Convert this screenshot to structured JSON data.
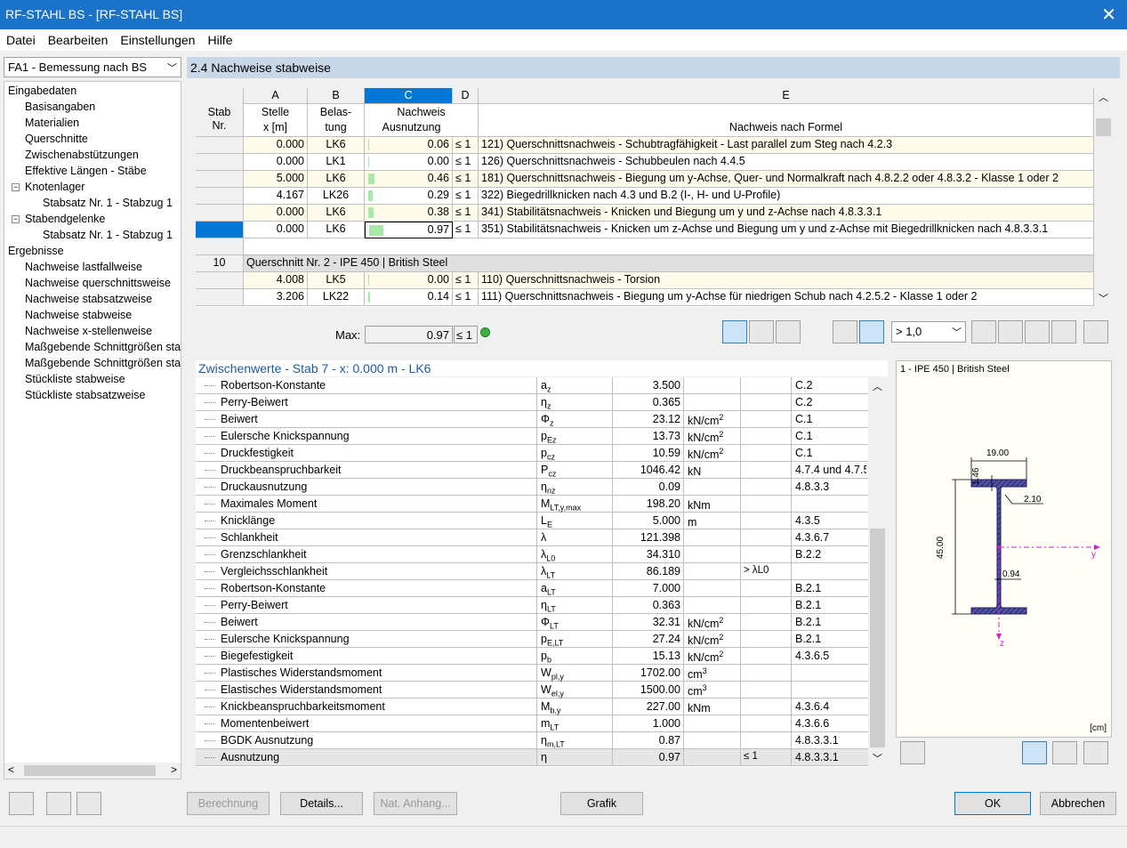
{
  "window": {
    "title": "RF-STAHL BS - [RF-STAHL BS]"
  },
  "menu": [
    "Datei",
    "Bearbeiten",
    "Einstellungen",
    "Hilfe"
  ],
  "case_select": "FA1 - Bemessung nach BS",
  "nav": {
    "input_header": "Eingabedaten",
    "input_items": [
      "Basisangaben",
      "Materialien",
      "Querschnitte",
      "Zwischenabstützungen",
      "Effektive Längen - Stäbe"
    ],
    "knotenlager": "Knotenlager",
    "knotenlager_child": "Stabsatz Nr. 1 - Stabzug 1",
    "stabendgelenke": "Stabendgelenke",
    "stabendgelenke_child": "Stabsatz Nr. 1 - Stabzug 1",
    "results_header": "Ergebnisse",
    "result_items": [
      "Nachweise lastfallweise",
      "Nachweise querschnittsweise",
      "Nachweise stabsatzweise",
      "Nachweise stabweise",
      "Nachweise x-stellenweise",
      "Maßgebende Schnittgrößen sta",
      "Maßgebende Schnittgrößen sta",
      "Stückliste stabweise",
      "Stückliste stabsatzweise"
    ]
  },
  "section_title": "2.4 Nachweise stabweise",
  "grid": {
    "col_letters": [
      "A",
      "B",
      "C",
      "D",
      "E"
    ],
    "h_stab": "Stab",
    "h_nr": "Nr.",
    "h_stelle": "Stelle",
    "h_x": "x [m]",
    "h_bel1": "Belas-",
    "h_bel2": "tung",
    "h_nach": "Nachweis",
    "h_aus": "Ausnutzung",
    "h_formel": "Nachweis nach Formel",
    "rows": [
      {
        "x": "0.000",
        "lk": "LK6",
        "val": "0.06",
        "le": "≤ 1",
        "f": "121) Querschnittsnachweis - Schubtragfähigkeit - Last parallel zum Steg nach 4.2.3",
        "fill": 0.06
      },
      {
        "x": "0.000",
        "lk": "LK1",
        "val": "0.00",
        "le": "≤ 1",
        "f": "126) Querschnittsnachweis - Schubbeulen nach 4.4.5",
        "fill": 0.0
      },
      {
        "x": "5.000",
        "lk": "LK6",
        "val": "0.46",
        "le": "≤ 1",
        "f": "181) Querschnittsnachweis - Biegung um y-Achse, Quer- und Normalkraft nach 4.8.2.2 oder 4.8.3.2 - Klasse 1 oder 2",
        "fill": 0.46
      },
      {
        "x": "4.167",
        "lk": "LK26",
        "val": "0.29",
        "le": "≤ 1",
        "f": "322) Biegedrillknicken nach 4.3 und B.2 (I-, H- und U-Profile)",
        "fill": 0.29
      },
      {
        "x": "0.000",
        "lk": "LK6",
        "val": "0.38",
        "le": "≤ 1",
        "f": "341) Stabilitätsnachweis - Knicken und Biegung um y und z-Achse nach 4.8.3.3.1",
        "fill": 0.38
      },
      {
        "x": "0.000",
        "lk": "LK6",
        "val": "0.97",
        "le": "≤ 1",
        "f": "351) Stabilitätsnachweis - Knicken um z-Achse und Biegung um y und z-Achse mit Biegedrillknicken nach 4.8.3.3.1",
        "fill": 0.97
      }
    ],
    "group_nr": "10",
    "group_label": "Querschnitt Nr.  2 - IPE 450 | British Steel",
    "rows2": [
      {
        "x": "4.008",
        "lk": "LK5",
        "val": "0.00",
        "le": "≤ 1",
        "f": "110) Querschnittsnachweis - Torsion",
        "fill": 0.0
      },
      {
        "x": "3.206",
        "lk": "LK22",
        "val": "0.14",
        "le": "≤ 1",
        "f": "111) Querschnittsnachweis - Biegung um y-Achse für niedrigen Schub nach 4.2.5.2 - Klasse 1 oder 2",
        "fill": 0.14
      }
    ]
  },
  "max": {
    "label": "Max:",
    "value": "0.97",
    "le": "≤ 1"
  },
  "factor_select": "> 1,0",
  "zw": {
    "title": "Zwischenwerte  -  Stab 7  -  x: 0.000 m  -  LK6",
    "rows": [
      {
        "n": "Robertson-Konstante",
        "s": "a",
        "sub": "z",
        "v": "3.500",
        "u": "",
        "u_sup": "",
        "cmp": "",
        "ref": "C.2"
      },
      {
        "n": "Perry-Beiwert",
        "s": "η",
        "sub": "z",
        "v": "0.365",
        "u": "",
        "u_sup": "",
        "cmp": "",
        "ref": "C.2"
      },
      {
        "n": "Beiwert",
        "s": "Φ",
        "sub": "z",
        "v": "23.12",
        "u": "kN/cm",
        "u_sup": "2",
        "cmp": "",
        "ref": "C.1"
      },
      {
        "n": "Eulersche Knickspannung",
        "s": "p",
        "sub": "Ez",
        "v": "13.73",
        "u": "kN/cm",
        "u_sup": "2",
        "cmp": "",
        "ref": "C.1"
      },
      {
        "n": "Druckfestigkeit",
        "s": "p",
        "sub": "cz",
        "v": "10.59",
        "u": "kN/cm",
        "u_sup": "2",
        "cmp": "",
        "ref": "C.1"
      },
      {
        "n": "Druckbeanspruchbarkeit",
        "s": "P",
        "sub": "cz",
        "v": "1046.42",
        "u": "kN",
        "u_sup": "",
        "cmp": "",
        "ref": "4.7.4 und 4.7.5"
      },
      {
        "n": "Druckausnutzung",
        "s": "η",
        "sub": "nz",
        "v": "0.09",
        "u": "",
        "u_sup": "",
        "cmp": "",
        "ref": "4.8.3.3"
      },
      {
        "n": "Maximales Moment",
        "s": "M",
        "sub": "LT,y,max",
        "v": "198.20",
        "u": "kNm",
        "u_sup": "",
        "cmp": "",
        "ref": ""
      },
      {
        "n": "Knicklänge",
        "s": "L",
        "sub": "E",
        "v": "5.000",
        "u": "m",
        "u_sup": "",
        "cmp": "",
        "ref": "4.3.5"
      },
      {
        "n": "Schlankheit",
        "s": "λ",
        "sub": "",
        "v": "121.398",
        "u": "",
        "u_sup": "",
        "cmp": "",
        "ref": "4.3.6.7"
      },
      {
        "n": "Grenzschlankheit",
        "s": "λ",
        "sub": "L0",
        "v": "34.310",
        "u": "",
        "u_sup": "",
        "cmp": "",
        "ref": "B.2.2"
      },
      {
        "n": "Vergleichsschlankheit",
        "s": "λ",
        "sub": "LT",
        "v": "86.189",
        "u": "",
        "u_sup": "",
        "cmp": "> λL0",
        "ref": ""
      },
      {
        "n": "Robertson-Konstante",
        "s": "a",
        "sub": "LT",
        "v": "7.000",
        "u": "",
        "u_sup": "",
        "cmp": "",
        "ref": "B.2.1"
      },
      {
        "n": "Perry-Beiwert",
        "s": "η",
        "sub": "LT",
        "v": "0.363",
        "u": "",
        "u_sup": "",
        "cmp": "",
        "ref": "B.2.1"
      },
      {
        "n": "Beiwert",
        "s": "Φ",
        "sub": "LT",
        "v": "32.31",
        "u": "kN/cm",
        "u_sup": "2",
        "cmp": "",
        "ref": "B.2.1"
      },
      {
        "n": "Eulersche Knickspannung",
        "s": "p",
        "sub": "E,LT",
        "v": "27.24",
        "u": "kN/cm",
        "u_sup": "2",
        "cmp": "",
        "ref": "B.2.1"
      },
      {
        "n": "Biegefestigkeit",
        "s": "p",
        "sub": "b",
        "v": "15.13",
        "u": "kN/cm",
        "u_sup": "2",
        "cmp": "",
        "ref": "4.3.6.5"
      },
      {
        "n": "Plastisches Widerstandsmoment",
        "s": "W",
        "sub": "pl,y",
        "v": "1702.00",
        "u": "cm",
        "u_sup": "3",
        "cmp": "",
        "ref": ""
      },
      {
        "n": "Elastisches Widerstandsmoment",
        "s": "W",
        "sub": "el,y",
        "v": "1500.00",
        "u": "cm",
        "u_sup": "3",
        "cmp": "",
        "ref": ""
      },
      {
        "n": "Knickbeanspruchbarkeitsmoment",
        "s": "M",
        "sub": "b,y",
        "v": "227.00",
        "u": "kNm",
        "u_sup": "",
        "cmp": "",
        "ref": "4.3.6.4"
      },
      {
        "n": "Momentenbeiwert",
        "s": "m",
        "sub": "LT",
        "v": "1.000",
        "u": "",
        "u_sup": "",
        "cmp": "",
        "ref": "4.3.6.6"
      },
      {
        "n": "BGDK Ausnutzung",
        "s": "η",
        "sub": "m,LT",
        "v": "0.87",
        "u": "",
        "u_sup": "",
        "cmp": "",
        "ref": "4.8.3.3.1"
      },
      {
        "n": "Ausnutzung",
        "s": "η",
        "sub": "",
        "v": "0.97",
        "u": "",
        "u_sup": "",
        "cmp": "≤ 1",
        "ref": "4.8.3.3.1"
      }
    ]
  },
  "figure": {
    "title": "1 - IPE 450 | British Steel",
    "dim_b": "19.00",
    "dim_tf": "1.46",
    "dim_r": "2.10",
    "dim_h": "45.00",
    "dim_tw": "0.94",
    "axis_y": "y",
    "axis_z": "z",
    "unit": "[cm]"
  },
  "buttons": {
    "berechnung": "Berechnung",
    "details": "Details...",
    "nat": "Nat. Anhang...",
    "grafik": "Grafik",
    "ok": "OK",
    "abbrechen": "Abbrechen"
  },
  "colors": {
    "title_bar": "#1a73c8",
    "accent": "#0078d7",
    "bar_fill": "#a8e8a8",
    "section": "#c8d8e8"
  }
}
